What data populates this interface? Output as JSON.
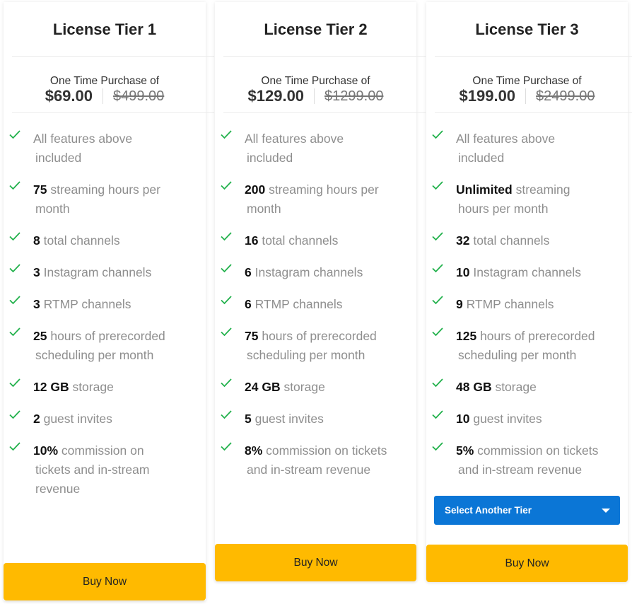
{
  "colors": {
    "accent_buy": "#ffba00",
    "accent_select": "#0b76d6",
    "check": "#22b14c"
  },
  "tiers": [
    {
      "title": "License Tier 1",
      "price_label": "One Time Purchase of",
      "price": "$69.00",
      "original_price": "$499.00",
      "features": [
        {
          "highlight": "",
          "line1": "All features above",
          "line2": "included"
        },
        {
          "highlight": "75",
          "line1": " streaming hours per",
          "line2": "month"
        },
        {
          "highlight": "8",
          "line1": " total channels",
          "line2": ""
        },
        {
          "highlight": "3",
          "line1": " Instagram channels",
          "line2": ""
        },
        {
          "highlight": "3",
          "line1": " RTMP channels",
          "line2": ""
        },
        {
          "highlight": "25",
          "line1": " hours of prerecorded",
          "line2": "scheduling per month"
        },
        {
          "highlight": "12 GB",
          "line1": " storage",
          "line2": ""
        },
        {
          "highlight": "2",
          "line1": " guest invites",
          "line2": ""
        },
        {
          "highlight": "10%",
          "line1": " commission on",
          "line2": "tickets and in-stream",
          "line3": "revenue"
        }
      ],
      "buy_label": "Buy Now"
    },
    {
      "title": "License Tier 2",
      "price_label": "One Time Purchase of",
      "price": "$129.00",
      "original_price": "$1299.00",
      "features": [
        {
          "highlight": "",
          "line1": "All features above",
          "line2": "included"
        },
        {
          "highlight": "200",
          "line1": " streaming hours per",
          "line2": "month"
        },
        {
          "highlight": "16",
          "line1": " total channels",
          "line2": ""
        },
        {
          "highlight": "6",
          "line1": " Instagram channels",
          "line2": ""
        },
        {
          "highlight": "6",
          "line1": " RTMP channels",
          "line2": ""
        },
        {
          "highlight": "75",
          "line1": " hours of prerecorded",
          "line2": "scheduling per month"
        },
        {
          "highlight": "24 GB",
          "line1": " storage",
          "line2": ""
        },
        {
          "highlight": "5",
          "line1": " guest invites",
          "line2": ""
        },
        {
          "highlight": "8%",
          "line1": " commission on tickets",
          "line2": "and in-stream revenue"
        }
      ],
      "buy_label": "Buy Now"
    },
    {
      "title": "License Tier 3",
      "price_label": "One Time Purchase of",
      "price": "$199.00",
      "original_price": "$2499.00",
      "features": [
        {
          "highlight": "",
          "line1": "All features above",
          "line2": "included"
        },
        {
          "highlight": "Unlimited",
          "line1": " streaming",
          "line2": "hours per month"
        },
        {
          "highlight": "32",
          "line1": " total channels",
          "line2": ""
        },
        {
          "highlight": "10",
          "line1": " Instagram channels",
          "line2": ""
        },
        {
          "highlight": "9",
          "line1": " RTMP channels",
          "line2": ""
        },
        {
          "highlight": "125",
          "line1": " hours of prerecorded",
          "line2": "scheduling per month"
        },
        {
          "highlight": "48 GB",
          "line1": " storage",
          "line2": ""
        },
        {
          "highlight": "10",
          "line1": " guest invites",
          "line2": ""
        },
        {
          "highlight": "5%",
          "line1": " commission on tickets",
          "line2": "and in-stream revenue"
        }
      ],
      "select_label": "Select Another Tier",
      "buy_label": "Buy Now"
    }
  ]
}
